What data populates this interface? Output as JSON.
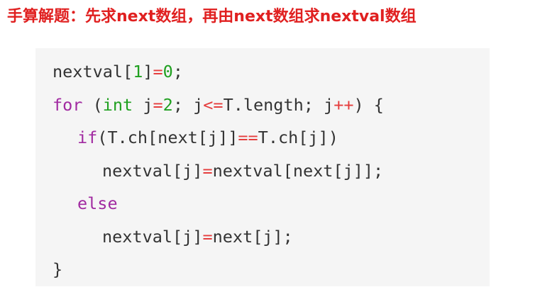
{
  "heading": {
    "text": "手算解题：先求next数组，再由next数组求nextval数组",
    "color": "#e02020"
  },
  "colors": {
    "plain": "#333333",
    "keyword": "#a12aa1",
    "type": "#20a020",
    "number": "#20a020",
    "operator": "#e53d3d",
    "background": "#f5f5f5"
  },
  "code": {
    "lines": [
      {
        "indent": 0,
        "tokens": [
          {
            "text": "nextval[",
            "kind": "plain"
          },
          {
            "text": "1",
            "kind": "number"
          },
          {
            "text": "]",
            "kind": "plain"
          },
          {
            "text": "=",
            "kind": "operator"
          },
          {
            "text": "0",
            "kind": "number"
          },
          {
            "text": ";",
            "kind": "plain"
          }
        ]
      },
      {
        "indent": 0,
        "tokens": [
          {
            "text": "for",
            "kind": "keyword"
          },
          {
            "text": " (",
            "kind": "plain"
          },
          {
            "text": "int",
            "kind": "type"
          },
          {
            "text": " j",
            "kind": "plain"
          },
          {
            "text": "=",
            "kind": "operator"
          },
          {
            "text": "2",
            "kind": "number"
          },
          {
            "text": "; j",
            "kind": "plain"
          },
          {
            "text": "<=",
            "kind": "operator"
          },
          {
            "text": "T.length; j",
            "kind": "plain"
          },
          {
            "text": "++",
            "kind": "operator"
          },
          {
            "text": ") {",
            "kind": "plain"
          }
        ]
      },
      {
        "indent": 1,
        "tokens": [
          {
            "text": "if",
            "kind": "keyword"
          },
          {
            "text": "(T.ch[next[j]]",
            "kind": "plain"
          },
          {
            "text": "==",
            "kind": "operator"
          },
          {
            "text": "T.ch[j])",
            "kind": "plain"
          }
        ]
      },
      {
        "indent": 2,
        "tokens": [
          {
            "text": "nextval[j]",
            "kind": "plain"
          },
          {
            "text": "=",
            "kind": "operator"
          },
          {
            "text": "nextval[next[j]];",
            "kind": "plain"
          }
        ]
      },
      {
        "indent": 1,
        "tokens": [
          {
            "text": "else",
            "kind": "keyword"
          }
        ]
      },
      {
        "indent": 2,
        "tokens": [
          {
            "text": "nextval[j]",
            "kind": "plain"
          },
          {
            "text": "=",
            "kind": "operator"
          },
          {
            "text": "next[j];",
            "kind": "plain"
          }
        ]
      },
      {
        "indent": 0,
        "tokens": [
          {
            "text": "}",
            "kind": "plain"
          }
        ]
      }
    ]
  }
}
